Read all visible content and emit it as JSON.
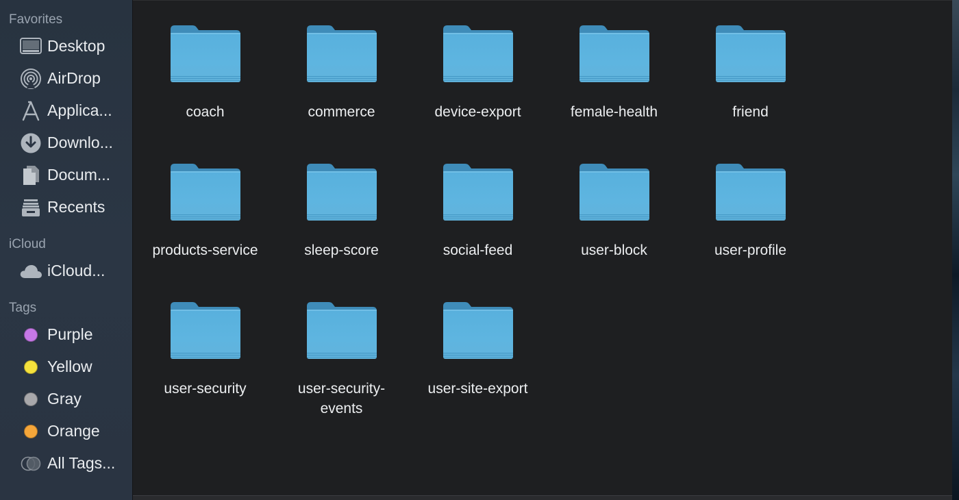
{
  "sidebar": {
    "favorites_header": "Favorites",
    "favorites": [
      {
        "label": "Desktop",
        "icon": "desktop-icon"
      },
      {
        "label": "AirDrop",
        "icon": "airdrop-icon"
      },
      {
        "label": "Applica...",
        "icon": "applications-icon"
      },
      {
        "label": "Downlo...",
        "icon": "downloads-icon"
      },
      {
        "label": "Docum...",
        "icon": "documents-icon"
      },
      {
        "label": "Recents",
        "icon": "recents-icon"
      }
    ],
    "icloud_header": "iCloud",
    "icloud": [
      {
        "label": "iCloud...",
        "icon": "icloud-icon"
      }
    ],
    "tags_header": "Tags",
    "tags": [
      {
        "label": "Purple",
        "color": "#c678e6"
      },
      {
        "label": "Yellow",
        "color": "#f5e13c"
      },
      {
        "label": "Gray",
        "color": "#a8a8ab"
      },
      {
        "label": "Orange",
        "color": "#f5a63a"
      },
      {
        "label": "All Tags...",
        "icon": "all-tags-icon"
      }
    ]
  },
  "folders": [
    "coach",
    "commerce",
    "device-export",
    "female-health",
    "friend",
    "products-service",
    "sleep-score",
    "social-feed",
    "user-block",
    "user-profile",
    "user-security",
    "user-security-\nevents",
    "user-site-export"
  ],
  "colors": {
    "folder_body": "#5bb2dd",
    "folder_tab": "#3f8fbe",
    "sidebar_bg": "#2a3442",
    "content_bg": "#1e1f21"
  }
}
